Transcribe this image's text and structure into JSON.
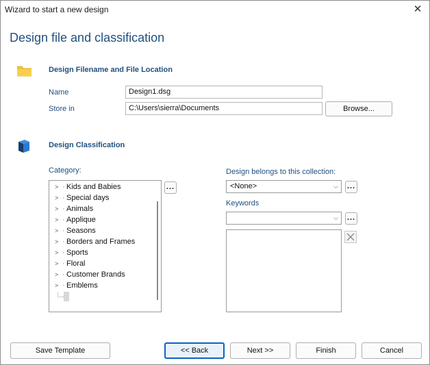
{
  "window": {
    "title": "Wizard to start a new design",
    "close_glyph": "✕"
  },
  "page_title": "Design file and classification",
  "file_section": {
    "heading": "Design Filename and File Location",
    "icon": "folder-icon",
    "name_label": "Name",
    "name_value": "Design1.dsg",
    "store_label": "Store in",
    "store_value": "C:\\Users\\sierra\\Documents",
    "browse_label": "Browse..."
  },
  "classification": {
    "heading": "Design Classification",
    "icon": "cube-icon",
    "category_label": "Category:",
    "category_more": "...",
    "categories": [
      "Kids and Babies",
      "Special days",
      "Animals",
      "Applique",
      "Seasons",
      "Borders and Frames",
      "Sports",
      "Floral",
      "Customer Brands",
      "Emblems"
    ],
    "collection_label": "Design belongs to this collection:",
    "collection_value": "<None>",
    "collection_more": "...",
    "keywords_label": "Keywords",
    "keywords_value": "",
    "keywords_more": "..."
  },
  "footer": {
    "save_template": "Save Template",
    "back": "<< Back",
    "next": "Next >>",
    "finish": "Finish",
    "cancel": "Cancel"
  },
  "colors": {
    "accent_text": "#21507f",
    "primary_border": "#0b63c5"
  }
}
